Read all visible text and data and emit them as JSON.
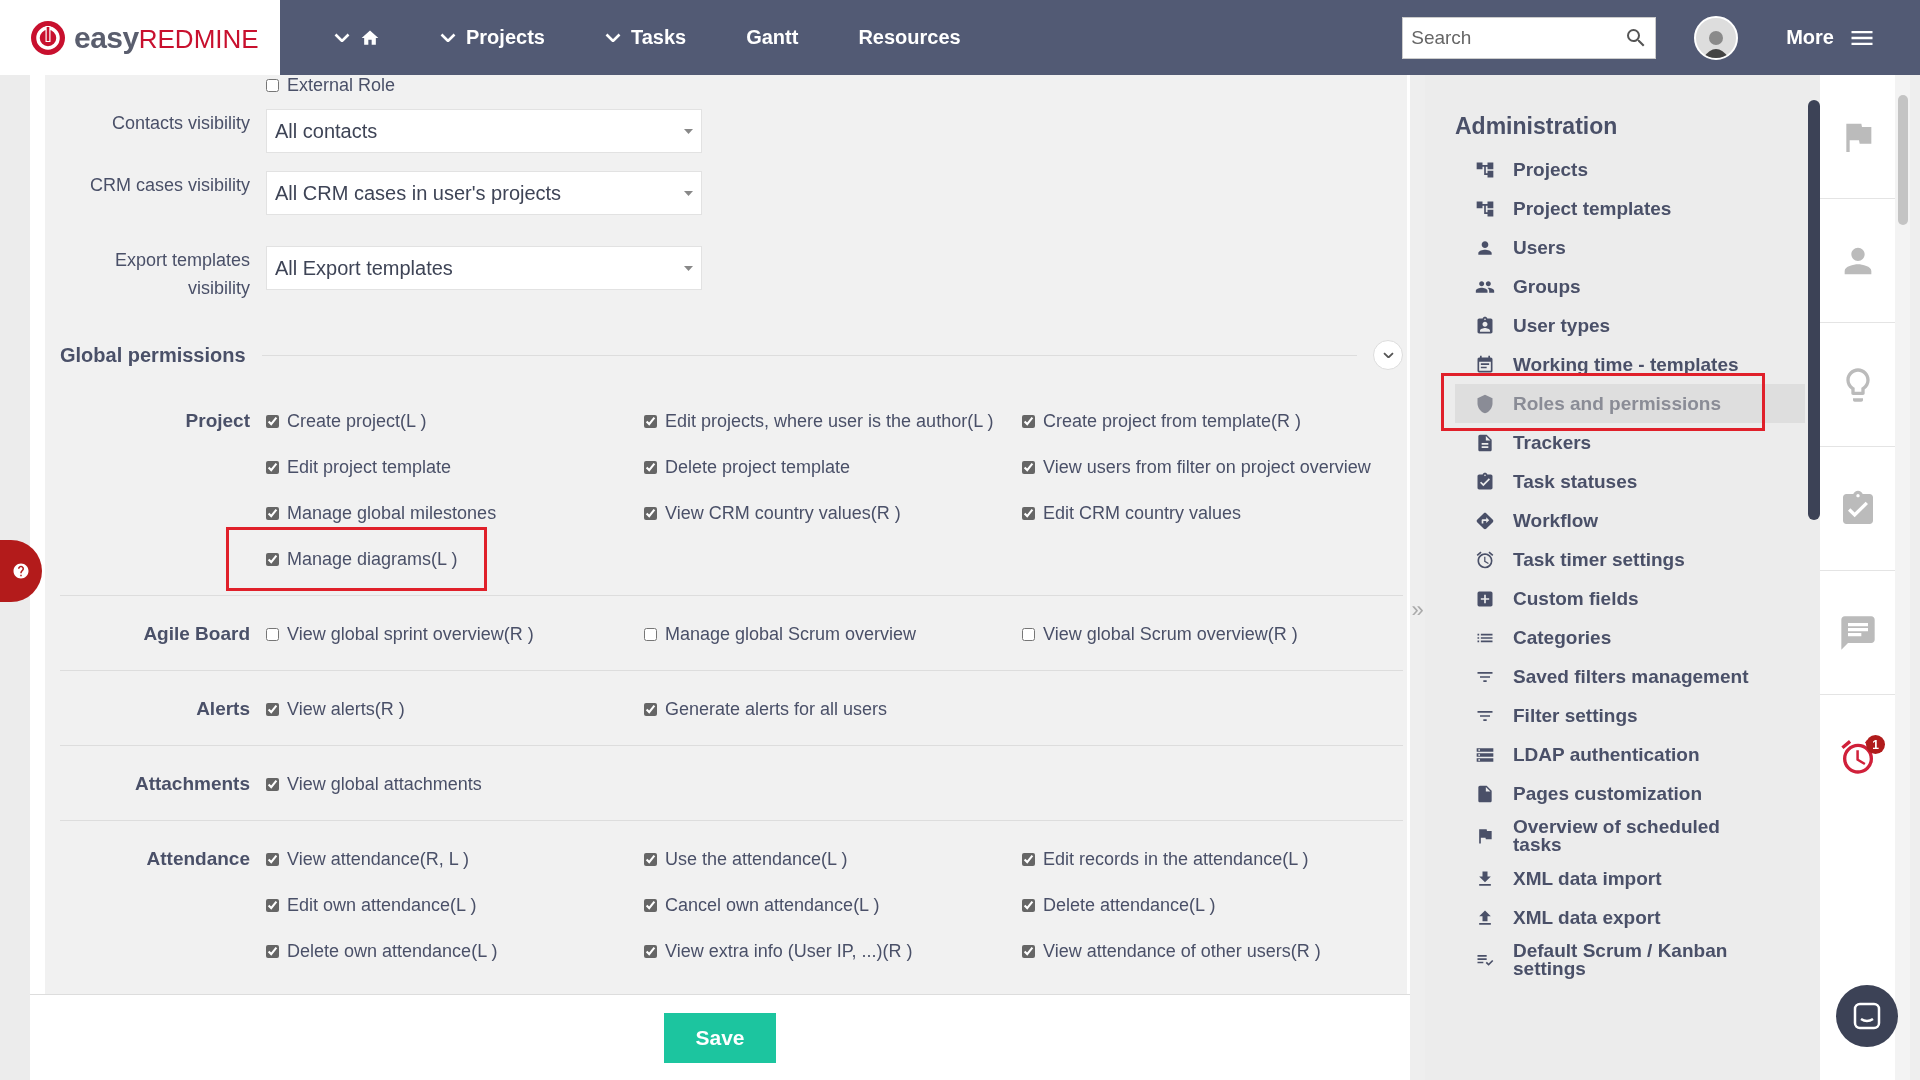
{
  "header": {
    "logo": {
      "prefix": "easy",
      "suffix": "REDMINE"
    },
    "nav": [
      {
        "label": "Projects",
        "has_menu": true
      },
      {
        "label": "Tasks",
        "has_menu": true
      },
      {
        "label": "Gantt",
        "has_menu": false
      },
      {
        "label": "Resources",
        "has_menu": false
      }
    ],
    "search": {
      "placeholder": "Search"
    },
    "more": "More"
  },
  "form": {
    "external_role": {
      "label": "External Role",
      "checked": false
    },
    "selects": [
      {
        "label": "Contacts visibility",
        "value": "All contacts"
      },
      {
        "label": "CRM cases visibility",
        "value": "All CRM cases in user's projects"
      },
      {
        "label": "Export templates visibility",
        "value": "All Export templates"
      }
    ]
  },
  "permissions": {
    "title": "Global permissions",
    "groups": [
      {
        "name": "Project",
        "items": [
          {
            "label": "Create project(L )",
            "checked": true,
            "annotated": false
          },
          {
            "label": "Edit projects, where user is the author(L )",
            "checked": true,
            "annotated": false
          },
          {
            "label": "Create project from template(R )",
            "checked": true,
            "annotated": false
          },
          {
            "label": "Edit project template",
            "checked": true,
            "annotated": false
          },
          {
            "label": "Delete project template",
            "checked": true,
            "annotated": false
          },
          {
            "label": "View users from filter on project overview",
            "checked": true,
            "annotated": false
          },
          {
            "label": "Manage global milestones",
            "checked": true,
            "annotated": false
          },
          {
            "label": "View CRM country values(R )",
            "checked": true,
            "annotated": false
          },
          {
            "label": "Edit CRM country values",
            "checked": true,
            "annotated": false
          },
          {
            "label": "Manage diagrams(L )",
            "checked": true,
            "annotated": true
          }
        ]
      },
      {
        "name": "Agile Board",
        "items": [
          {
            "label": "View global sprint overview(R )",
            "checked": false,
            "annotated": false
          },
          {
            "label": "Manage global Scrum overview",
            "checked": false,
            "annotated": false
          },
          {
            "label": "View global Scrum overview(R )",
            "checked": false,
            "annotated": false
          }
        ]
      },
      {
        "name": "Alerts",
        "items": [
          {
            "label": "View alerts(R )",
            "checked": true,
            "annotated": false
          },
          {
            "label": "Generate alerts for all users",
            "checked": true,
            "annotated": false
          }
        ]
      },
      {
        "name": "Attachments",
        "items": [
          {
            "label": "View global attachments",
            "checked": true,
            "annotated": false
          }
        ]
      },
      {
        "name": "Attendance",
        "items": [
          {
            "label": "View attendance(R, L )",
            "checked": true,
            "annotated": false
          },
          {
            "label": "Use the attendance(L )",
            "checked": true,
            "annotated": false
          },
          {
            "label": "Edit records in the attendance(L )",
            "checked": true,
            "annotated": false
          },
          {
            "label": "Edit own attendance(L )",
            "checked": true,
            "annotated": false
          },
          {
            "label": "Cancel own attendance(L )",
            "checked": true,
            "annotated": false
          },
          {
            "label": "Delete attendance(L )",
            "checked": true,
            "annotated": false
          },
          {
            "label": "Delete own attendance(L )",
            "checked": true,
            "annotated": false
          },
          {
            "label": "View extra info (User IP, ...)(R )",
            "checked": true,
            "annotated": false
          },
          {
            "label": "View attendance of other users(R )",
            "checked": true,
            "annotated": false
          }
        ]
      }
    ]
  },
  "save": "Save",
  "collapse": "»",
  "sidebar": {
    "title": "Administration",
    "items": [
      {
        "label": "Projects",
        "selected": false,
        "annotated": false
      },
      {
        "label": "Project templates",
        "selected": false,
        "annotated": false
      },
      {
        "label": "Users",
        "selected": false,
        "annotated": false
      },
      {
        "label": "Groups",
        "selected": false,
        "annotated": false
      },
      {
        "label": "User types",
        "selected": false,
        "annotated": false
      },
      {
        "label": "Working time - templates",
        "selected": false,
        "annotated": false
      },
      {
        "label": "Roles and permissions",
        "selected": true,
        "annotated": true
      },
      {
        "label": "Trackers",
        "selected": false,
        "annotated": false
      },
      {
        "label": "Task statuses",
        "selected": false,
        "annotated": false
      },
      {
        "label": "Workflow",
        "selected": false,
        "annotated": false
      },
      {
        "label": "Task timer settings",
        "selected": false,
        "annotated": false
      },
      {
        "label": "Custom fields",
        "selected": false,
        "annotated": false
      },
      {
        "label": "Categories",
        "selected": false,
        "annotated": false
      },
      {
        "label": "Saved filters management",
        "selected": false,
        "annotated": false
      },
      {
        "label": "Filter settings",
        "selected": false,
        "annotated": false
      },
      {
        "label": "LDAP authentication",
        "selected": false,
        "annotated": false
      },
      {
        "label": "Pages customization",
        "selected": false,
        "annotated": false
      },
      {
        "label": "Overview of scheduled tasks",
        "selected": false,
        "annotated": false
      },
      {
        "label": "XML data import",
        "selected": false,
        "annotated": false
      },
      {
        "label": "XML data export",
        "selected": false,
        "annotated": false
      },
      {
        "label": "Default Scrum / Kanban settings",
        "selected": false,
        "annotated": false
      }
    ]
  },
  "rail": {
    "alarm_badge": "1"
  }
}
